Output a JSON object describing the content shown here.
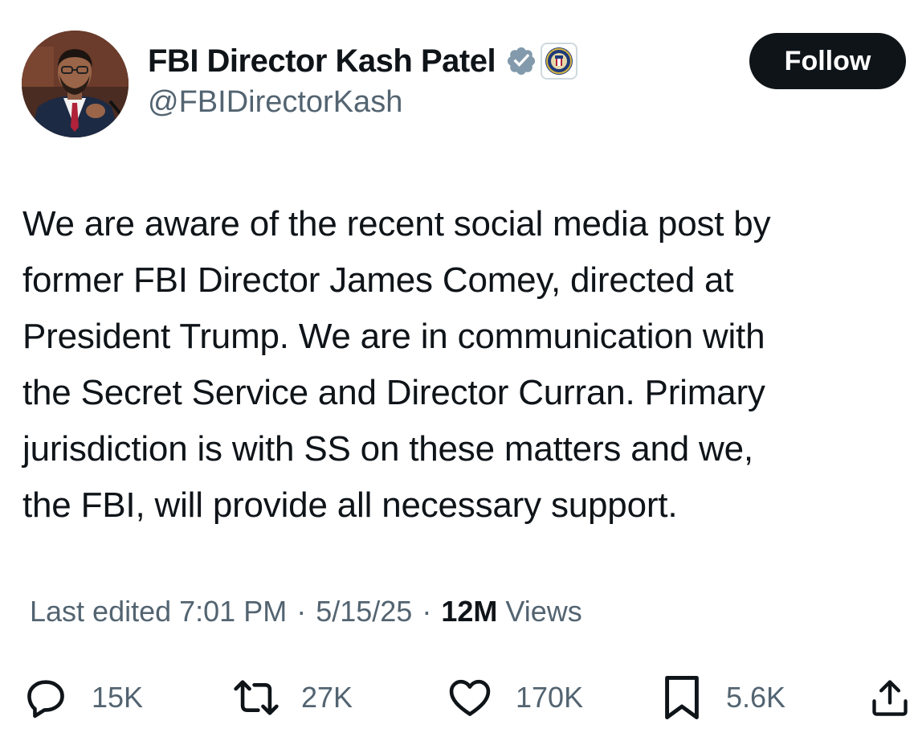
{
  "author": {
    "display_name": "FBI Director Kash Patel",
    "handle": "@FBIDirectorKash",
    "avatar": "avatar-photo",
    "verified_icon": "verified-badge-icon",
    "affiliate_badge": "fbi-seal-icon"
  },
  "follow_button": {
    "label": "Follow"
  },
  "post": {
    "lines": [
      "We are aware of the recent social media post by",
      "former FBI Director James Comey, directed at",
      "President Trump. We are in communication with",
      "the Secret Service and Director Curran. Primary",
      "jurisdiction is with SS on these matters and we,",
      "the FBI, will provide all necessary support."
    ]
  },
  "meta": {
    "edited_label": "Last edited 7:01 PM",
    "separator": "·",
    "date": "5/15/25",
    "views_count": "12M",
    "views_label": "Views"
  },
  "actions": {
    "replies": "15K",
    "reposts": "27K",
    "likes": "170K",
    "bookmarks": "5.6K",
    "icons": {
      "replies": "reply-icon",
      "reposts": "repost-icon",
      "likes": "like-icon",
      "bookmarks": "bookmark-icon",
      "share": "share-icon"
    }
  },
  "colors": {
    "text_primary": "#0f1419",
    "text_secondary": "#536471",
    "verified_gray": "#829aab",
    "button_bg": "#0f1419"
  }
}
